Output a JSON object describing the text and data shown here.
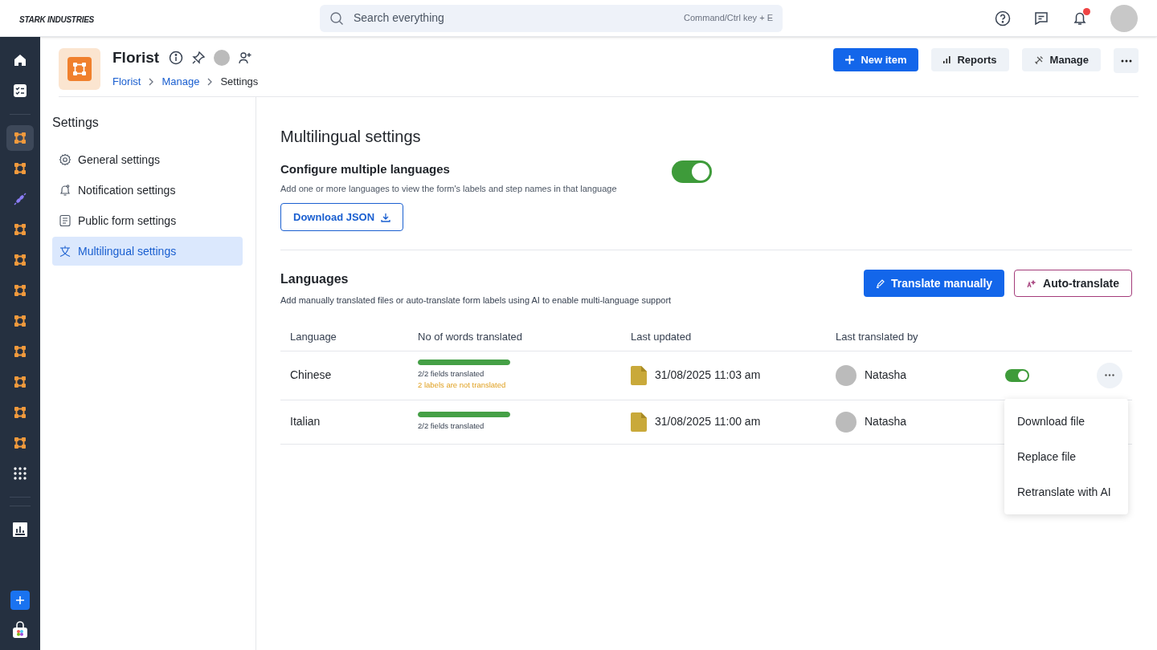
{
  "logo": "STARK INDUSTRIES",
  "search": {
    "placeholder": "Search everything",
    "shortcut": "Command/Ctrl key + E"
  },
  "top_icons": {
    "notification_dot": true
  },
  "rail": [
    {
      "kind": "home",
      "selected": false
    },
    {
      "kind": "tasks",
      "selected": false
    },
    {
      "kind": "app",
      "selected": true
    },
    {
      "kind": "app",
      "selected": false
    },
    {
      "kind": "integration",
      "selected": false
    },
    {
      "kind": "app",
      "selected": false
    },
    {
      "kind": "app",
      "selected": false
    },
    {
      "kind": "app",
      "selected": false
    },
    {
      "kind": "app",
      "selected": false
    },
    {
      "kind": "app",
      "selected": false
    },
    {
      "kind": "app",
      "selected": false
    },
    {
      "kind": "app",
      "selected": false
    },
    {
      "kind": "app",
      "selected": false
    },
    {
      "kind": "grid",
      "selected": false
    },
    {
      "kind": "reports",
      "selected": false
    }
  ],
  "header": {
    "title": "Florist",
    "breadcrumbs": [
      {
        "label": "Florist",
        "link": true
      },
      {
        "label": "Manage",
        "link": true
      },
      {
        "label": "Settings",
        "link": false
      }
    ],
    "buttons": [
      {
        "kind": "primary",
        "label": "New item"
      },
      {
        "kind": "reports",
        "label": "Reports"
      },
      {
        "kind": "manage",
        "label": "Manage"
      }
    ]
  },
  "settings_nav": {
    "title": "Settings",
    "items": [
      {
        "kind": "gear",
        "label": "General settings",
        "selected": false
      },
      {
        "kind": "bell",
        "label": "Notification settings",
        "selected": false
      },
      {
        "kind": "form",
        "label": "Public form settings",
        "selected": false
      },
      {
        "kind": "language",
        "label": "Multilingual settings",
        "selected": true
      }
    ]
  },
  "main": {
    "title": "Multilingual settings",
    "configure": {
      "title": "Configure multiple languages",
      "description": "Add one or more languages to view the form's labels and step names in that language",
      "on": true,
      "button": "Download JSON"
    },
    "languages": {
      "title": "Languages",
      "description": "Add manually translated files or auto-translate form labels using AI to enable multi-language support",
      "buttons": [
        {
          "kind": "primary",
          "label": "Translate manually"
        },
        {
          "kind": "outline",
          "label": "Auto-translate"
        }
      ],
      "columns": [
        "Language",
        "No of words translated",
        "Last updated",
        "Last translated by"
      ],
      "rows": [
        {
          "language": "Chinese",
          "level": 1,
          "fields": "2/2 fields translated",
          "warning": "2 labels are not translated",
          "updated": "31/08/2025 11:03 am",
          "user": "Natasha",
          "enabled": true
        },
        {
          "language": "Italian",
          "level": 1,
          "fields": "2/2 fields translated",
          "updated": "31/08/2025 11:00 am",
          "user": "Natasha"
        }
      ]
    },
    "context_menu": [
      "Download file",
      "Replace file",
      "Retranslate with AI"
    ]
  }
}
